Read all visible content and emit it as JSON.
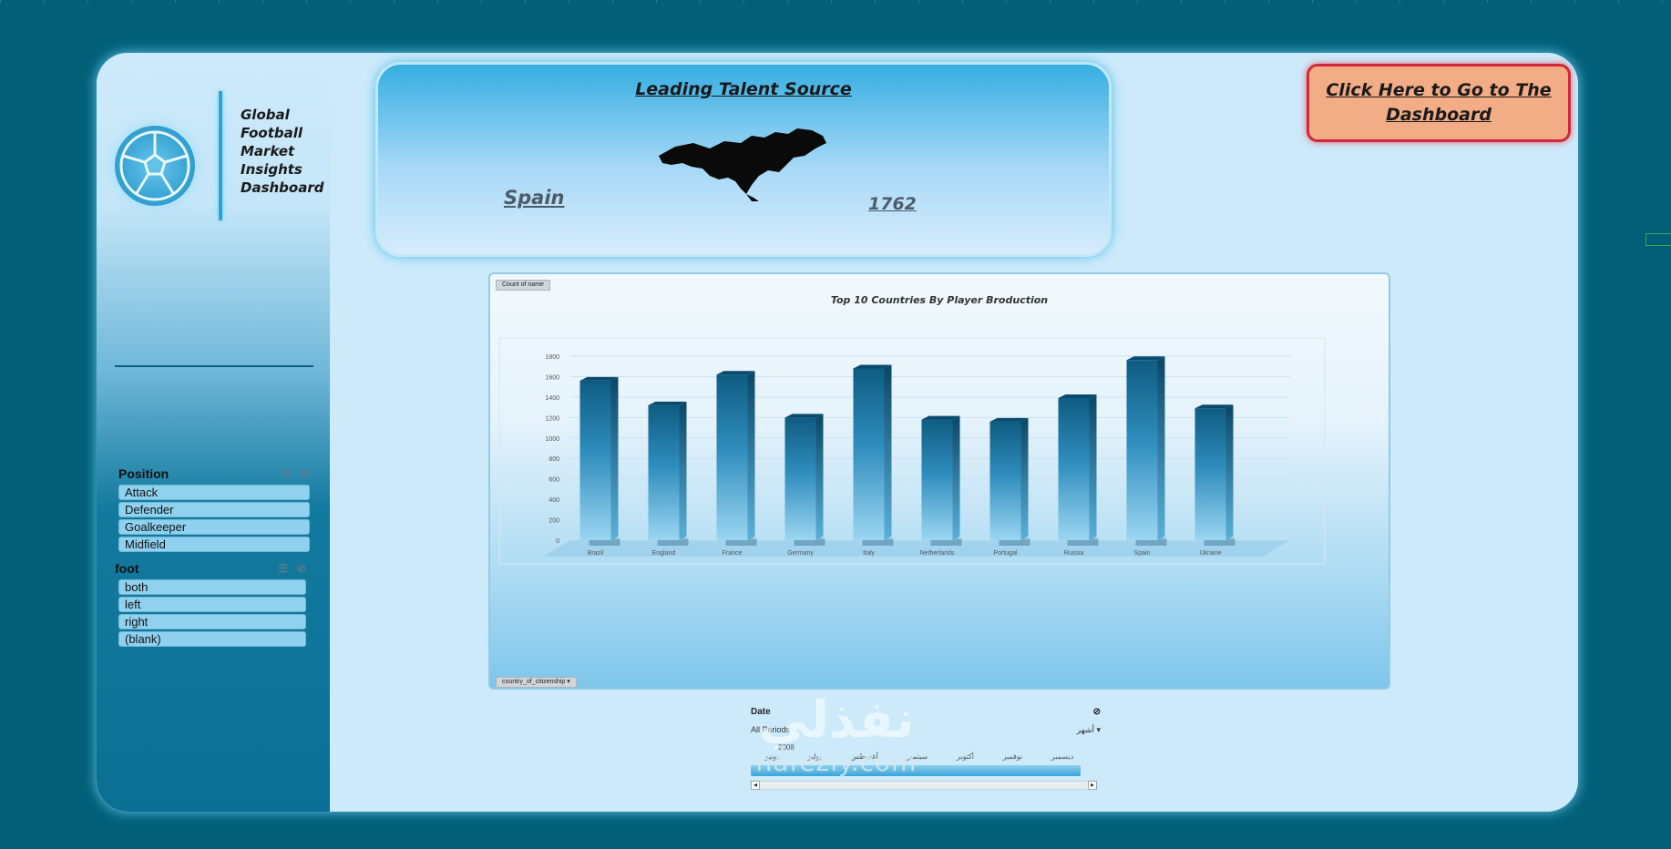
{
  "sidebar": {
    "title_lines": [
      "Global",
      "Football",
      "Market",
      "Insights",
      "Dashboard"
    ],
    "position_slicer": {
      "title": "Position",
      "items": [
        "Attack",
        "Defender",
        "Goalkeeper",
        "Midfield"
      ]
    },
    "foot_slicer": {
      "title": "foot",
      "items": [
        "both",
        "left",
        "right",
        "(blank)"
      ]
    }
  },
  "talent": {
    "title": "Leading Talent Source",
    "country": "Spain",
    "count": "1762"
  },
  "dashboard_button": {
    "label": "Click Here to Go to The Dashboard"
  },
  "chart_panel": {
    "value_field": "Count of name",
    "axis_field": "country_of_citizenship"
  },
  "chart_data": {
    "type": "bar",
    "title": "Top 10 Countries By Player Broduction",
    "categories": [
      "Brazil",
      "England",
      "France",
      "Germany",
      "Italy",
      "Netherlands",
      "Portugal",
      "Russia",
      "Spain",
      "Ukraine"
    ],
    "values": [
      1560,
      1320,
      1620,
      1200,
      1680,
      1180,
      1160,
      1390,
      1762,
      1290
    ],
    "yticks": [
      "0",
      "200",
      "400",
      "600",
      "800",
      "1000",
      "1200",
      "1400",
      "1600",
      "1800"
    ],
    "ylim": [
      0,
      1800
    ],
    "grid": true
  },
  "timeline": {
    "title": "Date",
    "periods_label": "All Periods",
    "level_label": "أشهر",
    "year": "2008",
    "months": [
      "يونيو",
      "يوليو",
      "أغسطس",
      "سبتمبر",
      "أكتوبر",
      "نوفمبر",
      "ديسمبر"
    ]
  },
  "watermark": {
    "arabic": "نفذلي",
    "latin": "nafezly.com"
  },
  "colors": {
    "background": "#035f78",
    "card": "#cdeafa",
    "button": "#f2ac86",
    "button_border": "#d02a3a"
  }
}
